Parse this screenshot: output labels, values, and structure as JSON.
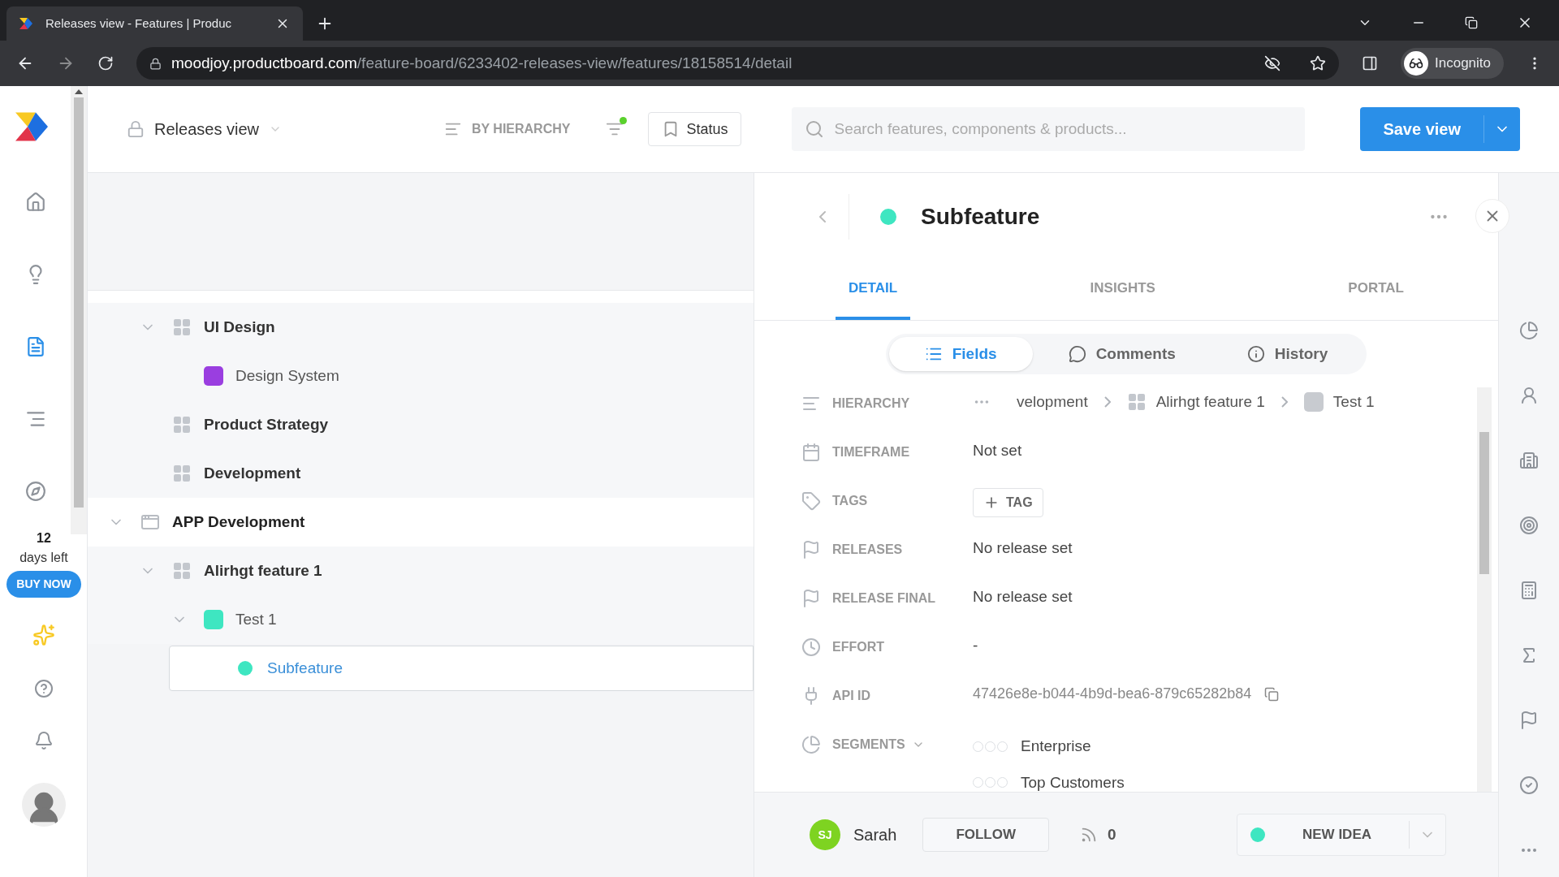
{
  "browser": {
    "tab_title": "Releases view - Features | Produc",
    "url_host": "moodjoy.productboard.com",
    "url_path": "/feature-board/6233402-releases-view/features/18158514/detail",
    "profile": "Incognito"
  },
  "nav": {
    "items": [
      {
        "kind": "home",
        "selected": false
      },
      {
        "kind": "insights",
        "selected": false
      },
      {
        "kind": "features",
        "selected": true
      },
      {
        "kind": "roadmaps",
        "selected": false
      },
      {
        "kind": "portal",
        "selected": false
      }
    ],
    "trial": {
      "days": "12",
      "label": "days left",
      "button": "BUY NOW"
    }
  },
  "header": {
    "view_name": "Releases view",
    "grouping": "BY HIERARCHY",
    "filter_active": true,
    "status_button": "Status",
    "search_placeholder": "Search features, components & products...",
    "save_button": "Save view"
  },
  "tree": {
    "scrolled_parent_children": [
      {
        "kind": "component",
        "label": "UI Design",
        "expanded": true,
        "selected": false,
        "children": [
          {
            "kind": "feature",
            "label": "Design System",
            "color": "#9a3ee0",
            "selected": false
          }
        ]
      },
      {
        "kind": "component",
        "label": "Product Strategy",
        "selected": false
      },
      {
        "kind": "component",
        "label": "Development",
        "selected": false
      }
    ],
    "items": [
      {
        "kind": "product",
        "label": "APP Development",
        "expanded": true,
        "selected": false,
        "children": [
          {
            "kind": "component",
            "label": "Alirhgt feature 1",
            "expanded": true,
            "selected": false,
            "children": [
              {
                "kind": "feature",
                "label": "Test 1",
                "color": "#3ee6c1",
                "expanded": true,
                "selected": false,
                "children": [
                  {
                    "kind": "subfeature",
                    "label": "Subfeature",
                    "color": "#3ee6c1",
                    "selected": true
                  }
                ]
              }
            ]
          }
        ]
      }
    ]
  },
  "detail": {
    "title": "Subfeature",
    "tabs": [
      {
        "label": "DETAIL",
        "selected": true
      },
      {
        "label": "INSIGHTS",
        "selected": false
      },
      {
        "label": "PORTAL",
        "selected": false
      }
    ],
    "subtabs": [
      {
        "kind": "fields",
        "label": "Fields",
        "selected": true
      },
      {
        "kind": "comments",
        "label": "Comments",
        "selected": false
      },
      {
        "kind": "history",
        "label": "History",
        "selected": false
      }
    ],
    "fields": [
      {
        "kind": "hierarchy",
        "label": "HIERARCHY",
        "path": [
          {
            "kind": "text",
            "label": "velopment"
          },
          {
            "kind": "component",
            "label": "Alirhgt feature 1"
          },
          {
            "kind": "feature",
            "label": "Test 1"
          }
        ]
      },
      {
        "kind": "timeframe",
        "label": "TIMEFRAME",
        "value": "Not set"
      },
      {
        "kind": "tags",
        "label": "TAGS",
        "button": "TAG"
      },
      {
        "kind": "releases",
        "label": "RELEASES",
        "value": "No release set"
      },
      {
        "kind": "release_final",
        "label": "RELEASE FINAL",
        "value": "No release set"
      },
      {
        "kind": "effort",
        "label": "EFFORT",
        "value": "-"
      },
      {
        "kind": "api_id",
        "label": "API ID",
        "value": "47426e8e-b044-4b9d-bea6-879c65282b84"
      },
      {
        "kind": "segments",
        "label": "SEGMENTS",
        "segments": [
          {
            "label": "Enterprise",
            "stars": 0
          },
          {
            "label": "Top Customers",
            "stars": 0
          }
        ]
      }
    ],
    "footer": {
      "owner_initials": "SJ",
      "owner_name": "Sarah",
      "follow": "FOLLOW",
      "insights_count": "0",
      "status": "NEW IDEA"
    }
  }
}
